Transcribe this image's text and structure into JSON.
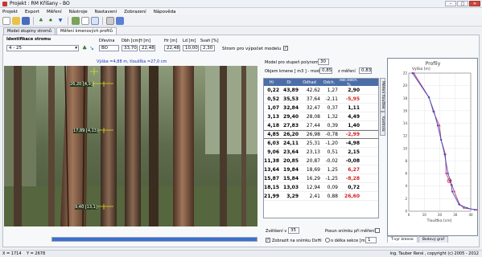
{
  "window": {
    "title": "Projekt : RM Kříšany - BO"
  },
  "menu": [
    "Projekt",
    "Export",
    "Měření",
    "Nástroje",
    "Nastavení",
    "Zobrazení",
    "Nápověda"
  ],
  "tabs": [
    "Model skupiny stromů",
    "Měření kmenových profilů"
  ],
  "tree": {
    "label": "Identifikace stromu",
    "value": "4 - 25"
  },
  "fields": {
    "species_label": "Dřevina",
    "species": "BO",
    "dbh_label": "Dbh [cm]",
    "dbh": "33,70",
    "h_label": "H [m]",
    "h": "22,48",
    "hr_label": "Hr [m]",
    "hr": "22,48",
    "ld_label": "Ld [m]",
    "ld": "10,00",
    "svah_label": "Svah [%]",
    "svah": "2,30",
    "model_tree_label": "Strom pro výpočet modelu",
    "model_tree_checked": true
  },
  "photo": {
    "caption": "Výška =4,88 m, tloušťka =27,0 cm",
    "markers": [
      "26,20 [4,9]",
      "17,89 [4,13]",
      "9,40 [13,1]"
    ]
  },
  "model": {
    "degree_label": "Model pro stupeň polynomu :",
    "degree": "30",
    "volume_label": "Objem kmene [ m3 ] - model",
    "volume": "0,85",
    "zmer_label": "z měření",
    "zmer": "0,83"
  },
  "table": {
    "headers": [
      "Hi",
      "Di",
      "Odhad",
      "Odch.",
      "Rel.odch. %"
    ],
    "rows": [
      [
        "0,22",
        "43,89",
        "42,62",
        "1,27",
        "2,90",
        ""
      ],
      [
        "0,52",
        "35,53",
        "37,64",
        "-2,11",
        "-5,95",
        "red5"
      ],
      [
        "1,07",
        "32,84",
        "32,47",
        "0,37",
        "1,11",
        ""
      ],
      [
        "3,13",
        "29,40",
        "28,08",
        "1,32",
        "4,49",
        ""
      ],
      [
        "4,18",
        "27,83",
        "27,44",
        "0,39",
        "1,40",
        ""
      ],
      [
        "4,85",
        "26,20",
        "26,98",
        "-0,78",
        "-2,99",
        "sel"
      ],
      [
        "6,03",
        "24,11",
        "25,31",
        "-1,20",
        "-4,98",
        ""
      ],
      [
        "9,06",
        "23,64",
        "23,13",
        "0,51",
        "2,15",
        ""
      ],
      [
        "11,38",
        "20,85",
        "20,87",
        "-0,02",
        "-0,08",
        ""
      ],
      [
        "13,64",
        "19,84",
        "18,69",
        "1,25",
        "6,27",
        "red4"
      ],
      [
        "15,87",
        "15,84",
        "16,29",
        "-1,25",
        "-8,28",
        "red4"
      ],
      [
        "18,15",
        "13,03",
        "12,94",
        "0,09",
        "0,72",
        ""
      ],
      [
        "21,99",
        "3,29",
        "2,41",
        "0,88",
        "26,60",
        "red4"
      ]
    ]
  },
  "vtabs": [
    "Měření tloušťek",
    "Kontrola"
  ],
  "bottom": {
    "zoom_label": "Zvětšení v %",
    "zoom": "35",
    "show_label": "Zobrazit na snímku DxHi",
    "show_checked": true,
    "posun_label": "Posun snímku při měření",
    "sekce_label": "o délka sekce [m]",
    "sekce": "1"
  },
  "graph_tabs": [
    "T-vyr kmene",
    "Bodový graf"
  ],
  "chart_data": {
    "type": "line",
    "title": "Profily",
    "xlabel": "Tloušťka [cm]",
    "ylabel": "Výška [m]",
    "xlim": [
      0,
      40
    ],
    "ylim": [
      0,
      22
    ],
    "xticks": [
      0,
      10,
      20,
      30,
      40
    ],
    "yticks": [
      0,
      2,
      4,
      6,
      8,
      10,
      12,
      14,
      16,
      18,
      20,
      22
    ],
    "series": [
      {
        "values": [
          [
            43.89,
            0.22
          ],
          [
            35.53,
            0.52
          ],
          [
            32.84,
            1.07
          ],
          [
            29.4,
            3.13
          ],
          [
            27.83,
            4.18
          ],
          [
            26.2,
            4.85
          ],
          [
            24.11,
            6.03
          ],
          [
            23.64,
            9.06
          ],
          [
            20.85,
            11.38
          ],
          [
            19.84,
            13.64
          ],
          [
            15.84,
            15.87
          ],
          [
            13.03,
            18.15
          ],
          [
            3.29,
            21.99
          ]
        ],
        "color": "#c63a77"
      },
      {
        "values": [
          [
            42.62,
            0.22
          ],
          [
            37.64,
            0.52
          ],
          [
            32.47,
            1.07
          ],
          [
            28.08,
            3.13
          ],
          [
            27.44,
            4.18
          ],
          [
            26.98,
            4.85
          ],
          [
            25.31,
            6.03
          ],
          [
            23.13,
            9.06
          ],
          [
            20.87,
            11.38
          ],
          [
            18.69,
            13.64
          ],
          [
            16.29,
            15.87
          ],
          [
            12.94,
            18.15
          ],
          [
            2.41,
            21.99
          ]
        ],
        "color": "#3b4fb8"
      }
    ],
    "selected": [
      26.2,
      4.85
    ]
  },
  "status": {
    "x": "X = 1714",
    "y": "Y = 2678",
    "copyright": "ing. Tauber René , copyright (c) 2005 - 2012"
  }
}
